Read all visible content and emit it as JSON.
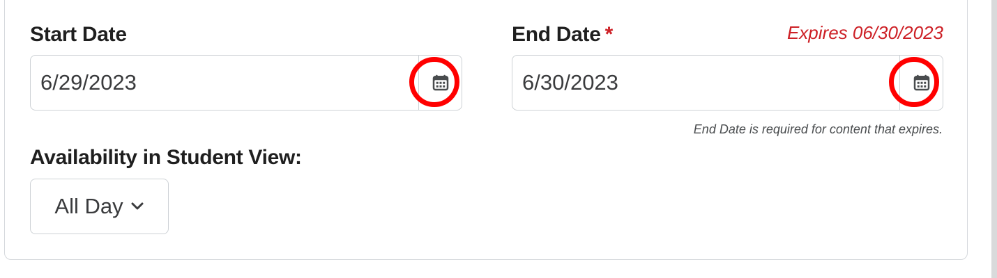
{
  "start_date": {
    "label": "Start Date",
    "value": "6/29/2023"
  },
  "end_date": {
    "label": "End Date",
    "required_marker": "*",
    "expires_notice": "Expires 06/30/2023",
    "value": "6/30/2023",
    "help_text": "End Date is required for content that expires."
  },
  "availability": {
    "label": "Availability in Student View:",
    "selected": "All Day"
  },
  "icons": {
    "calendar": "calendar-icon",
    "chevron": "chevron-down-icon"
  },
  "colors": {
    "required_red": "#cd2026",
    "highlight_ring": "#ff0000",
    "border": "#cdd1d5"
  }
}
